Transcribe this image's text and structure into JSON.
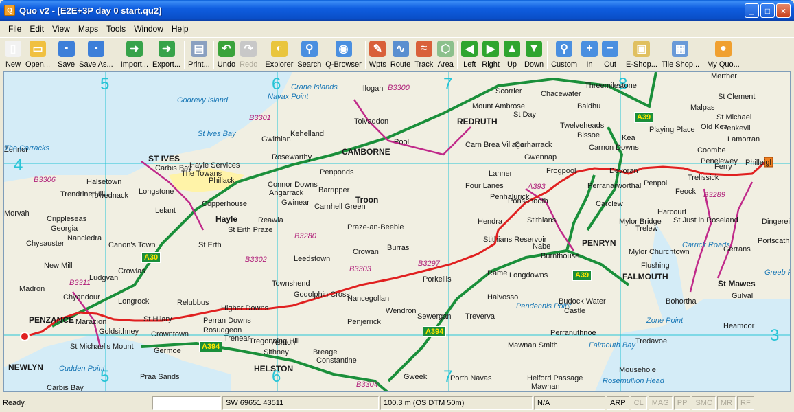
{
  "window": {
    "title": "Quo v2 - [E2E+3P day 0 start.qu2]",
    "app_icon": "Q"
  },
  "menu": [
    "File",
    "Edit",
    "View",
    "Maps",
    "Tools",
    "Window",
    "Help"
  ],
  "toolbar": {
    "buttons": [
      {
        "label": "New",
        "icon": "new-icon",
        "color": "#f2f2f2"
      },
      {
        "label": "Open...",
        "icon": "open-folder-icon",
        "color": "#f0c040"
      },
      {
        "label": "Save",
        "icon": "save-disk-icon",
        "color": "#3d7fd9"
      },
      {
        "label": "Save As...",
        "icon": "save-as-icon",
        "color": "#3d7fd9"
      },
      {
        "label": "Import...",
        "icon": "import-icon",
        "color": "#37a34a"
      },
      {
        "label": "Export...",
        "icon": "export-icon",
        "color": "#37a34a"
      },
      {
        "label": "Print...",
        "icon": "print-icon",
        "color": "#8aa0c0"
      },
      {
        "label": "Undo",
        "icon": "undo-arrow-icon",
        "color": "#3aa33a"
      },
      {
        "label": "Redo",
        "icon": "redo-arrow-icon",
        "color": "#c8c8c8",
        "disabled": true
      },
      {
        "label": "Explorer",
        "icon": "explorer-icon",
        "color": "#e9c53d"
      },
      {
        "label": "Search",
        "icon": "search-magnifier-icon",
        "color": "#4a8fe0"
      },
      {
        "label": "Q-Browser",
        "icon": "q-browser-icon",
        "color": "#4a8fe0"
      },
      {
        "label": "Wpts",
        "icon": "waypoints-icon",
        "color": "#d9603a"
      },
      {
        "label": "Route",
        "icon": "route-icon",
        "color": "#5a8fd0"
      },
      {
        "label": "Track",
        "icon": "track-icon",
        "color": "#d9603a"
      },
      {
        "label": "Area",
        "icon": "area-icon",
        "color": "#8cc08c"
      },
      {
        "label": "Left",
        "icon": "arrow-left-icon",
        "color": "#2fa52f"
      },
      {
        "label": "Right",
        "icon": "arrow-right-icon",
        "color": "#2fa52f"
      },
      {
        "label": "Up",
        "icon": "arrow-up-icon",
        "color": "#2fa52f"
      },
      {
        "label": "Down",
        "icon": "arrow-down-icon",
        "color": "#2fa52f"
      },
      {
        "label": "Custom",
        "icon": "zoom-custom-icon",
        "color": "#4a8fe0"
      },
      {
        "label": "In",
        "icon": "zoom-in-icon",
        "color": "#4a8fe0"
      },
      {
        "label": "Out",
        "icon": "zoom-out-icon",
        "color": "#4a8fe0"
      },
      {
        "label": "E-Shop...",
        "icon": "e-shop-icon",
        "color": "#e0c060"
      },
      {
        "label": "Tile Shop...",
        "icon": "tile-shop-icon",
        "color": "#6a9ad8"
      },
      {
        "label": "My Quo...",
        "icon": "user-icon",
        "color": "#f0a030"
      }
    ],
    "separators_after": [
      1,
      3,
      5,
      6,
      8,
      11,
      15,
      19,
      22,
      24
    ]
  },
  "map": {
    "grid_numbers": [
      "5",
      "6",
      "7",
      "8",
      "4",
      "5",
      "6",
      "7",
      "3"
    ],
    "places": [
      "Godrevy Island",
      "Crane Islands",
      "Navax Point",
      "Illogan",
      "Scorrier",
      "Chacewater",
      "Threemilestone",
      "Merther",
      "St Clement",
      "Malpas",
      "Baldhu",
      "Twelveheads",
      "Bissoe",
      "Playing Place",
      "Old Kea",
      "Penkevil",
      "Lamorran",
      "St Michael",
      "Tolvaddon",
      "Mount Ambrose",
      "REDRUTH",
      "St Day",
      "Carharrack",
      "Carnon Downs",
      "Coombe",
      "Penelewey",
      "Kea",
      "Gwithian",
      "Kehelland",
      "Rosewarthy",
      "CAMBORNE",
      "Pool",
      "Carn Brea Village",
      "Gwennap",
      "Frogpool",
      "Devoran",
      "Ferry",
      "Philleigh",
      "St Ives Bay",
      "ST IVES",
      "Carbis Bay",
      "The Towans",
      "Hayle Services",
      "Phillack",
      "Connor Downs",
      "Angarrack",
      "Gwinear",
      "Barripper",
      "Penponds",
      "Four Lanes",
      "Lanner",
      "Perranarworthal",
      "Penpol",
      "Trelissick",
      "Feock",
      "Halsetown",
      "Towednack",
      "Longstone",
      "Trendrine Hill",
      "Copperhouse",
      "Lelant",
      "Hayle",
      "Carnhell Green",
      "Troon",
      "Praze-an-Beeble",
      "Penhalurick",
      "Ponsanooth",
      "Stithians",
      "Hendra",
      "Carclew",
      "Mylor Bridge",
      "Trelew",
      "Harcourt",
      "St Just in Roseland",
      "Dingerein Castle",
      "Crippleseas",
      "Georgia",
      "Nancledra",
      "Canon's Town",
      "St Erth Praze",
      "St Erth",
      "Reawla",
      "Stithians Reservoir",
      "PENRYN",
      "Nabe",
      "Burnthouse",
      "Mylor Churchtown",
      "Flushing",
      "Carrick Roads",
      "Gerrans",
      "Portscatho",
      "New Mill",
      "Chysauster",
      "Crowlas",
      "Leedstown",
      "Crowan",
      "Burras",
      "Porkellis",
      "Rame",
      "Longdowns",
      "FALMOUTH",
      "St Mawes",
      "Greeb Point",
      "Madron",
      "Ludgvan",
      "Longrock",
      "Townshend",
      "Godolphin Cross",
      "Nancegollan",
      "Halvosso",
      "Budock Water",
      "Castle",
      "Bohortha",
      "Gulval",
      "Chyandour",
      "Marazion",
      "St Hilary",
      "Relubbus",
      "Higher Downs",
      "Perran Downs",
      "Rosudgeon",
      "Trenear",
      "Wendron",
      "Sewergan",
      "Treverva",
      "Pendennis Point",
      "Zone Point",
      "Heamoor",
      "PENZANCE",
      "St Michael's Mount",
      "Goldsithney",
      "Crowntown",
      "Penjerrick",
      "Perranuthnoe",
      "Germoe",
      "Tregonning Hill",
      "Ashton",
      "Sithney",
      "Breage",
      "Constantine",
      "Mawnan Smith",
      "Falmouth Bay",
      "Tredavoe",
      "NEWLYN",
      "Cudden Point",
      "Praa Sands",
      "HELSTON",
      "Gweek",
      "Porth Navas",
      "Helford Passage",
      "Mawnan",
      "Rosemullion Head",
      "Mousehole",
      "Carbis Bay",
      "Zennor",
      "The Carracks",
      "Morvah"
    ],
    "roads_green": [
      "A39",
      "A30",
      "A394",
      "A394",
      "A39"
    ],
    "roads_magenta": [
      "B3301",
      "B3300",
      "B3306",
      "B3311",
      "B3302",
      "B3280",
      "B3303",
      "B3297",
      "A393",
      "B3289",
      "B3304"
    ]
  },
  "statusbar": {
    "status": "Ready.",
    "field_blank": "",
    "grid_ref": "SW 69651 43511",
    "elevation": "100.3 m (OS DTM 50m)",
    "na": "N/A",
    "flags": [
      "ARP",
      "CL",
      "MAG",
      "PP",
      "SMC",
      "MR",
      "RF"
    ],
    "flags_dim": [
      "CL",
      "MAG",
      "PP",
      "SMC",
      "MR",
      "RF"
    ]
  }
}
